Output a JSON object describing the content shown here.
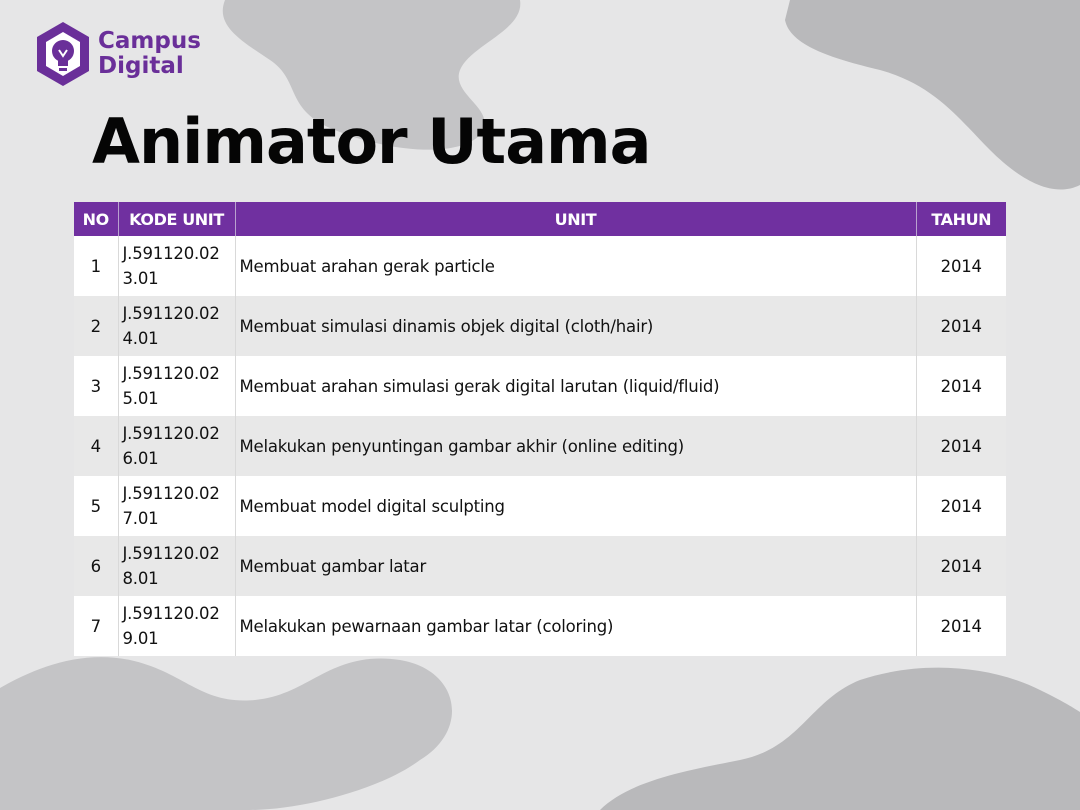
{
  "brand": {
    "line1": "Campus",
    "line2": "Digital",
    "color": "#6a2f99"
  },
  "page_title": "Animator Utama",
  "table": {
    "header_color": "#7030a0",
    "headers": {
      "no": "NO",
      "kode": "KODE UNIT",
      "unit": "UNIT",
      "tahun": "TAHUN"
    },
    "rows": [
      {
        "no": "1",
        "kode_line1": "J.591120.02",
        "kode_line2": "3.01",
        "unit": "Membuat arahan gerak particle",
        "tahun": "2014"
      },
      {
        "no": "2",
        "kode_line1": "J.591120.02",
        "kode_line2": "4.01",
        "unit": "Membuat simulasi dinamis objek digital (cloth/hair)",
        "tahun": "2014"
      },
      {
        "no": "3",
        "kode_line1": "J.591120.02",
        "kode_line2": "5.01",
        "unit": "Membuat arahan simulasi gerak digital larutan (liquid/fluid)",
        "tahun": "2014"
      },
      {
        "no": "4",
        "kode_line1": "J.591120.02",
        "kode_line2": "6.01",
        "unit": "Melakukan penyuntingan gambar akhir (online editing)",
        "tahun": "2014"
      },
      {
        "no": "5",
        "kode_line1": "J.591120.02",
        "kode_line2": "7.01",
        "unit": "Membuat model digital sculpting",
        "tahun": "2014"
      },
      {
        "no": "6",
        "kode_line1": "J.591120.02",
        "kode_line2": "8.01",
        "unit": "Membuat gambar latar",
        "tahun": "2014"
      },
      {
        "no": "7",
        "kode_line1": "J.591120.02",
        "kode_line2": "9.01",
        "unit": "Melakukan pewarnaan gambar latar (coloring)",
        "tahun": "2014"
      }
    ]
  }
}
